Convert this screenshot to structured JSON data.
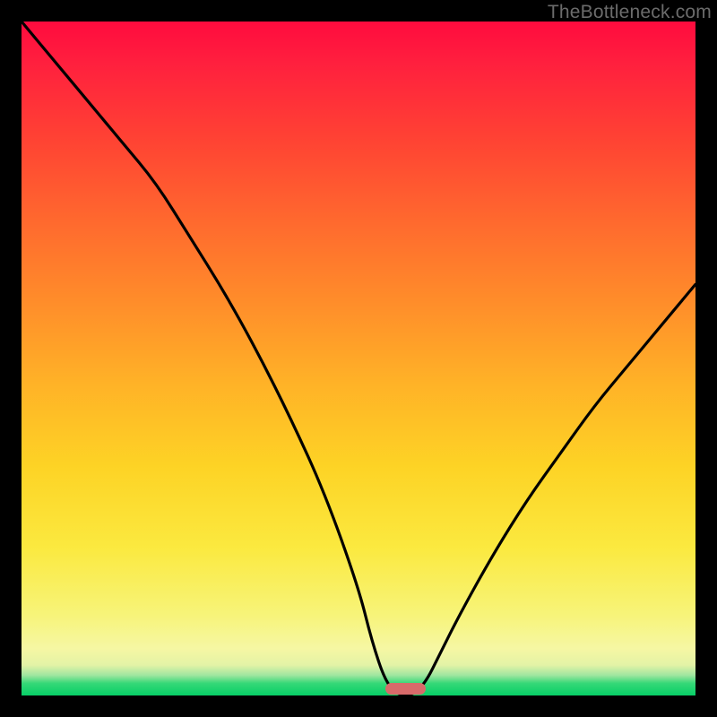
{
  "watermark": "TheBottleneck.com",
  "colors": {
    "background": "#000000",
    "gradient_top": "#ff0b3e",
    "gradient_bottom": "#07cf67",
    "curve": "#000000",
    "marker": "#d86a6a",
    "watermark_text": "#6b6b6b"
  },
  "chart_data": {
    "type": "line",
    "title": "",
    "xlabel": "",
    "ylabel": "",
    "xlim": [
      0,
      100
    ],
    "ylim": [
      0,
      100
    ],
    "grid": false,
    "legend": false,
    "x": [
      0,
      5,
      10,
      15,
      20,
      25,
      30,
      35,
      40,
      45,
      50,
      52,
      54,
      56,
      58,
      60,
      62,
      65,
      70,
      75,
      80,
      85,
      90,
      95,
      100
    ],
    "values": [
      100,
      94,
      88,
      82,
      76,
      68,
      60,
      51,
      41,
      30,
      16,
      8,
      2,
      0,
      0,
      2,
      6,
      12,
      21,
      29,
      36,
      43,
      49,
      55,
      61
    ],
    "marker": {
      "x_center": 57,
      "width": 6,
      "y": 0
    },
    "notes": "x is horizontal position as percent of plot width (left=0). values is vertical height as percent of plot height above the bottom edge (0 = bottom). Curve touches bottom near x≈56–58. Right branch rises to ≈61% at x=100."
  }
}
